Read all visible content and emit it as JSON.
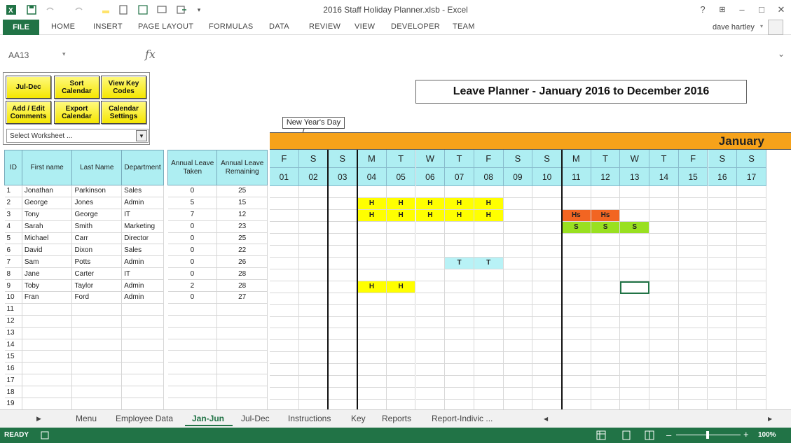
{
  "window": {
    "title": "2016 Staff Holiday Planner.xlsb - Excel",
    "help": "?",
    "user": "dave hartley"
  },
  "ribbon": {
    "file": "FILE",
    "tabs": [
      "HOME",
      "INSERT",
      "PAGE LAYOUT",
      "FORMULAS",
      "DATA",
      "REVIEW",
      "VIEW",
      "DEVELOPER",
      "TEAM"
    ]
  },
  "formula_bar": {
    "name_box": "AA13",
    "fx": "fx"
  },
  "buttons": {
    "jul_dec": "Jul-Dec",
    "sort_line1": "Sort",
    "sort_line2": "Calendar",
    "viewkey_line1": "View Key",
    "viewkey_line2": "Codes",
    "addedit_line1": "Add / Edit",
    "addedit_line2": "Comments",
    "export_line1": "Export",
    "export_line2": "Calendar",
    "calset_line1": "Calendar",
    "calset_line2": "Settings",
    "select_worksheet": "Select Worksheet ..."
  },
  "planner_title": "Leave Planner - January 2016 to December 2016",
  "callout": "New Year's Day",
  "month": "January",
  "employee_headers": {
    "id": "ID",
    "first": "First name",
    "last": "Last Name",
    "dept": "Department",
    "taken_l1": "Annual Leave",
    "taken_l2": "Taken",
    "remaining_l1": "Annual Leave",
    "remaining_l2": "Remaining"
  },
  "employees": [
    {
      "id": "1",
      "first": "Jonathan",
      "last": "Parkinson",
      "dept": "Sales",
      "taken": "0",
      "remaining": "25"
    },
    {
      "id": "2",
      "first": "George",
      "last": "Jones",
      "dept": "Admin",
      "taken": "5",
      "remaining": "15"
    },
    {
      "id": "3",
      "first": "Tony",
      "last": "George",
      "dept": "IT",
      "taken": "7",
      "remaining": "12"
    },
    {
      "id": "4",
      "first": "Sarah",
      "last": "Smith",
      "dept": "Marketing",
      "taken": "0",
      "remaining": "23"
    },
    {
      "id": "5",
      "first": "Michael",
      "last": "Carr",
      "dept": "Director",
      "taken": "0",
      "remaining": "25"
    },
    {
      "id": "6",
      "first": "David",
      "last": "Dixon",
      "dept": "Sales",
      "taken": "0",
      "remaining": "22"
    },
    {
      "id": "7",
      "first": "Sam",
      "last": "Potts",
      "dept": "Admin",
      "taken": "0",
      "remaining": "26"
    },
    {
      "id": "8",
      "first": "Jane",
      "last": "Carter",
      "dept": "IT",
      "taken": "0",
      "remaining": "28"
    },
    {
      "id": "9",
      "first": "Toby",
      "last": "Taylor",
      "dept": "Admin",
      "taken": "2",
      "remaining": "28"
    },
    {
      "id": "10",
      "first": "Fran",
      "last": "Ford",
      "dept": "Admin",
      "taken": "0",
      "remaining": "27"
    },
    {
      "id": "11",
      "first": "",
      "last": "",
      "dept": "",
      "taken": "",
      "remaining": ""
    },
    {
      "id": "12",
      "first": "",
      "last": "",
      "dept": "",
      "taken": "",
      "remaining": ""
    },
    {
      "id": "13",
      "first": "",
      "last": "",
      "dept": "",
      "taken": "",
      "remaining": ""
    },
    {
      "id": "14",
      "first": "",
      "last": "",
      "dept": "",
      "taken": "",
      "remaining": ""
    },
    {
      "id": "15",
      "first": "",
      "last": "",
      "dept": "",
      "taken": "",
      "remaining": ""
    },
    {
      "id": "16",
      "first": "",
      "last": "",
      "dept": "",
      "taken": "",
      "remaining": ""
    },
    {
      "id": "17",
      "first": "",
      "last": "",
      "dept": "",
      "taken": "",
      "remaining": ""
    },
    {
      "id": "18",
      "first": "",
      "last": "",
      "dept": "",
      "taken": "",
      "remaining": ""
    },
    {
      "id": "19",
      "first": "",
      "last": "",
      "dept": "",
      "taken": "",
      "remaining": ""
    }
  ],
  "calendar": {
    "days": [
      "F",
      "S",
      "S",
      "M",
      "T",
      "W",
      "T",
      "F",
      "S",
      "S",
      "M",
      "T",
      "W",
      "T",
      "F",
      "S",
      "S"
    ],
    "dates": [
      "01",
      "02",
      "03",
      "04",
      "05",
      "06",
      "07",
      "08",
      "09",
      "10",
      "11",
      "12",
      "13",
      "14",
      "15",
      "16",
      "17"
    ],
    "leave": [
      {
        "row": 1,
        "col": 3,
        "code": "H",
        "color": "#ffff00"
      },
      {
        "row": 1,
        "col": 4,
        "code": "H",
        "color": "#ffff00"
      },
      {
        "row": 1,
        "col": 5,
        "code": "H",
        "color": "#ffff00"
      },
      {
        "row": 1,
        "col": 6,
        "code": "H",
        "color": "#ffff00"
      },
      {
        "row": 1,
        "col": 7,
        "code": "H",
        "color": "#ffff00"
      },
      {
        "row": 2,
        "col": 3,
        "code": "H",
        "color": "#ffff00"
      },
      {
        "row": 2,
        "col": 4,
        "code": "H",
        "color": "#ffff00"
      },
      {
        "row": 2,
        "col": 5,
        "code": "H",
        "color": "#ffff00"
      },
      {
        "row": 2,
        "col": 6,
        "code": "H",
        "color": "#ffff00"
      },
      {
        "row": 2,
        "col": 7,
        "code": "H",
        "color": "#ffff00"
      },
      {
        "row": 2,
        "col": 10,
        "code": "Hs",
        "color": "#f26522"
      },
      {
        "row": 2,
        "col": 11,
        "code": "Hs",
        "color": "#f26522"
      },
      {
        "row": 3,
        "col": 10,
        "code": "S",
        "color": "#99e020"
      },
      {
        "row": 3,
        "col": 11,
        "code": "S",
        "color": "#99e020"
      },
      {
        "row": 3,
        "col": 12,
        "code": "S",
        "color": "#99e020"
      },
      {
        "row": 6,
        "col": 6,
        "code": "T",
        "color": "#b8f2f6"
      },
      {
        "row": 6,
        "col": 7,
        "code": "T",
        "color": "#b8f2f6"
      },
      {
        "row": 8,
        "col": 3,
        "code": "H",
        "color": "#ffff00"
      },
      {
        "row": 8,
        "col": 4,
        "code": "H",
        "color": "#ffff00"
      }
    ]
  },
  "sheet_tabs": [
    "Menu",
    "Employee Data",
    "Jan-Jun",
    "Jul-Dec",
    "Instructions",
    "Key",
    "Reports",
    "Report-Indivic ..."
  ],
  "active_tab": "Jan-Jun",
  "status": {
    "ready": "READY",
    "zoom": "100%"
  },
  "colors": {
    "excel_green": "#217346",
    "header_cyan": "#aeeef2",
    "month_orange": "#f6a21a",
    "button_yellow": "#f5e600"
  }
}
